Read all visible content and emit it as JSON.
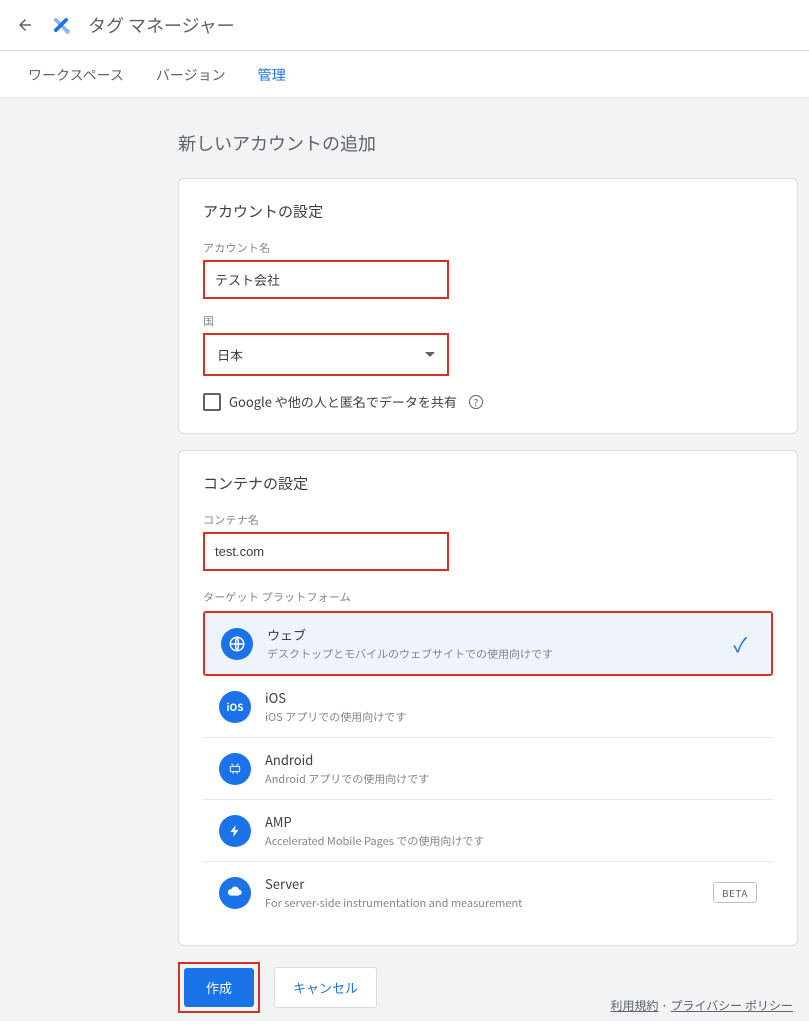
{
  "header": {
    "app_title": "タグ マネージャー"
  },
  "tabs": {
    "workspace": "ワークスペース",
    "version": "バージョン",
    "admin": "管理"
  },
  "page": {
    "title": "新しいアカウントの追加"
  },
  "account_section": {
    "title": "アカウントの設定",
    "name_label": "アカウント名",
    "name_value": "テスト会社",
    "country_label": "国",
    "country_value": "日本",
    "share_label": "Google や他の人と匿名でデータを共有",
    "help_glyph": "?"
  },
  "container_section": {
    "title": "コンテナの設定",
    "name_label": "コンテナ名",
    "name_value": "test.com",
    "platform_label": "ターゲット プラットフォーム",
    "platforms": [
      {
        "name": "ウェブ",
        "desc": "デスクトップとモバイルのウェブサイトでの使用向けです",
        "selected": true
      },
      {
        "name": "iOS",
        "desc": "iOS アプリでの使用向けです"
      },
      {
        "name": "Android",
        "desc": "Android アプリでの使用向けです"
      },
      {
        "name": "AMP",
        "desc": "Accelerated Mobile Pages での使用向けです"
      },
      {
        "name": "Server",
        "desc": "For server-side instrumentation and measurement",
        "badge": "BETA"
      }
    ]
  },
  "actions": {
    "create": "作成",
    "cancel": "キャンセル"
  },
  "footer": {
    "terms": "利用規約",
    "sep": " · ",
    "privacy": "プライバシー ポリシー"
  }
}
